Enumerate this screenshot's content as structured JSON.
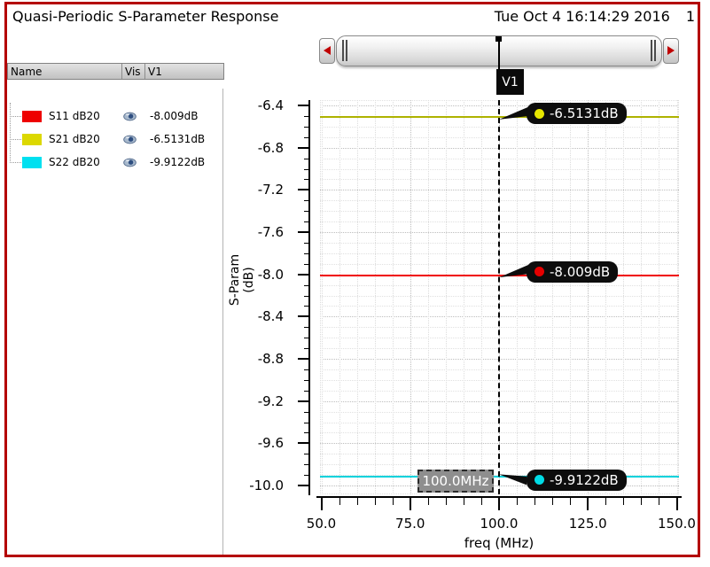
{
  "window": {
    "title": "Quasi-Periodic S-Parameter Response",
    "timestamp": "Tue Oct 4 16:14:29 2016",
    "page": "1"
  },
  "scrollbar": {
    "marker_label": "V1"
  },
  "legend": {
    "headers": {
      "name": "Name",
      "vis": "Vis",
      "v1": "V1"
    },
    "rows": [
      {
        "name": "S11 dB20",
        "swatch_color": "#ee0000",
        "value": "-8.009dB"
      },
      {
        "name": "S21 dB20",
        "swatch_color": "#dcd800",
        "value": "-6.5131dB"
      },
      {
        "name": "S22 dB20",
        "swatch_color": "#00e0f0",
        "value": "-9.9122dB"
      }
    ]
  },
  "chart_data": {
    "type": "line",
    "title": "Quasi-Periodic S-Parameter Response",
    "xlabel": "freq (MHz)",
    "ylabel": "S-Param (dB)",
    "xlim": [
      50,
      150
    ],
    "ylim": [
      -10.0,
      -6.4
    ],
    "x_ticks": [
      "50.0",
      "75.0",
      "100.0",
      "125.0",
      "150.0"
    ],
    "y_ticks": [
      "-6.4",
      "-6.8",
      "-7.2",
      "-7.6",
      "-8.0",
      "-8.4",
      "-8.8",
      "-9.2",
      "-9.6",
      "-10.0"
    ],
    "x_minor_step": 5,
    "y_minor_step": 0.1,
    "grid": true,
    "series": [
      {
        "name": "S11 dB20",
        "color": "#f00000",
        "value": -8.009,
        "marker_label": "-8.009dB",
        "dot_color": "#e60000"
      },
      {
        "name": "S21 dB20",
        "color": "#aeb200",
        "value": -6.5131,
        "marker_label": "-6.5131dB",
        "dot_color": "#e6e600"
      },
      {
        "name": "S22 dB20",
        "color": "#00d2dc",
        "value": -9.9122,
        "marker_label": "-9.9122dB",
        "dot_color": "#00dce6"
      }
    ],
    "marker": {
      "label": "V1",
      "x": 100,
      "x_label": "100.0MHz"
    }
  }
}
